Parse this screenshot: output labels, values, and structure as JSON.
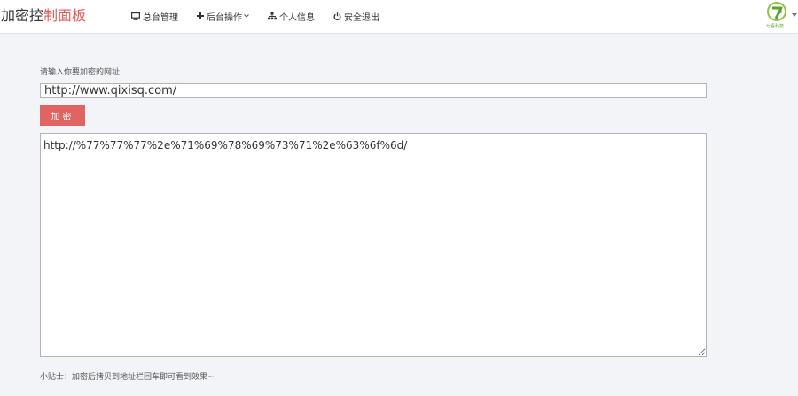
{
  "brand": {
    "title_main": "加密控",
    "title_accent": "制面板"
  },
  "nav": {
    "items": [
      {
        "label": "总台管理",
        "icon": "monitor-icon"
      },
      {
        "label": "后台操作",
        "icon": "plus-icon"
      },
      {
        "label": "个人信息",
        "icon": "sitemap-icon"
      },
      {
        "label": "安全退出",
        "icon": "power-icon"
      }
    ]
  },
  "logo": {
    "text": "七喜科技"
  },
  "form": {
    "prompt": "请输入你要加密的网址:",
    "url_value": "http://www.qixisq.com/",
    "button_label": "加密",
    "result_value": "http://%77%77%77%2e%71%69%78%69%73%71%2e%63%6f%6d/"
  },
  "tip": "小贴士：加密后拷贝到地址栏回车即可看到效果~",
  "colors": {
    "accent": "#e15b57",
    "button": "#e06461",
    "logo_green": "#5aa32a"
  }
}
